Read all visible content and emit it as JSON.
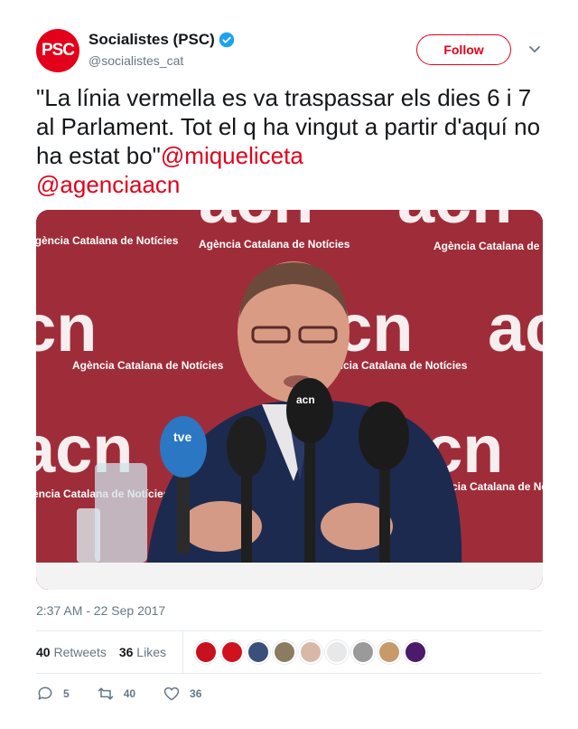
{
  "author": {
    "avatar_text": "PSC",
    "display_name": "Socialistes (PSC)",
    "handle": "@socialistes_cat"
  },
  "follow_label": "Follow",
  "tweet": {
    "text": "\"La línia vermella es va traspassar els dies 6 i 7 al Parlament. Tot el q ha vingut a partir d'aquí no ha estat bo\"",
    "mentions": [
      "@miqueliceta",
      "@agenciaacn"
    ]
  },
  "media": {
    "logo_text": "acn",
    "caption_text": "Agència Catalana de Notícies",
    "mic_label": "acn",
    "mic_label_tve": "tve"
  },
  "timestamp": "2:37 AM - 22 Sep 2017",
  "stats": {
    "retweets_count": "40",
    "retweets_label": "Retweets",
    "likes_count": "36",
    "likes_label": "Likes"
  },
  "actions": {
    "replies": "5",
    "retweets": "40",
    "likes": "36"
  },
  "colors": {
    "brand": "#e2001a",
    "secondary_text": "#657786"
  }
}
